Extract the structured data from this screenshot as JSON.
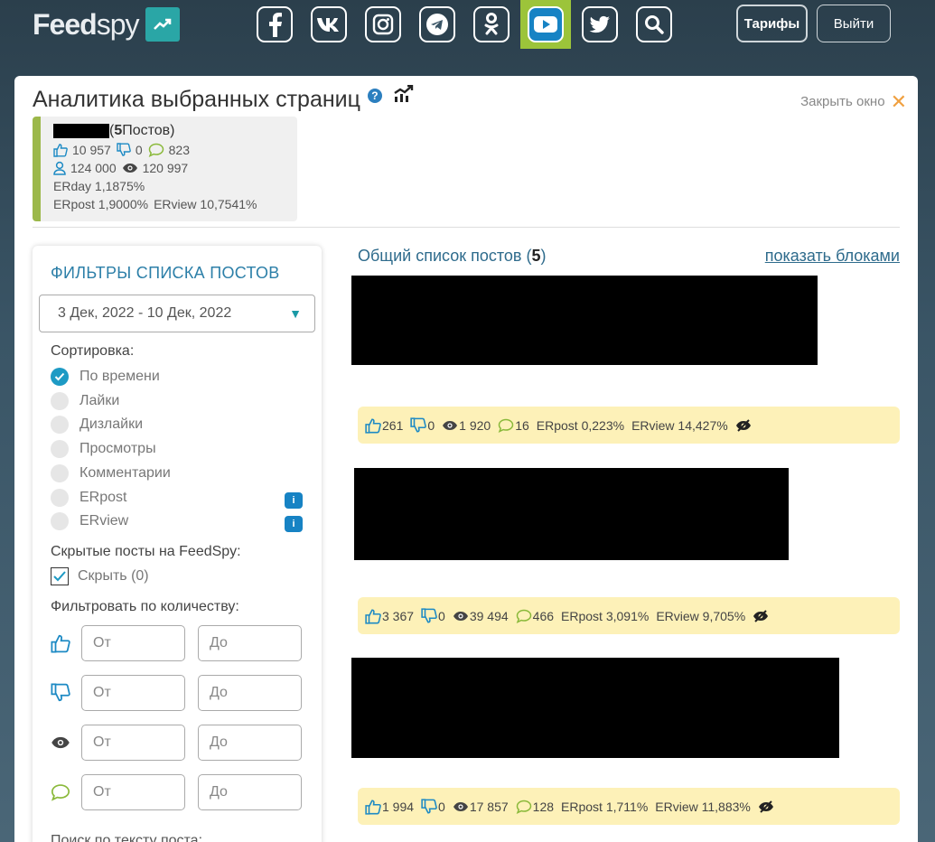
{
  "brand": {
    "feed": "Feed",
    "spy": "spy"
  },
  "nav": [
    {
      "name": "facebook-icon",
      "glyph": "f"
    },
    {
      "name": "vk-icon",
      "glyph": "vk"
    },
    {
      "name": "instagram-icon",
      "glyph": "ig"
    },
    {
      "name": "telegram-icon",
      "glyph": "tg"
    },
    {
      "name": "odnoklassniki-icon",
      "glyph": "ok"
    },
    {
      "name": "youtube-icon",
      "glyph": "yt",
      "active": true
    },
    {
      "name": "twitter-icon",
      "glyph": "tw"
    },
    {
      "name": "search-icon",
      "glyph": "search"
    }
  ],
  "header": {
    "tariffs_label": "Тарифы",
    "exit_label": "Выйти"
  },
  "page": {
    "title": "Аналитика выбранных страниц",
    "help": "?",
    "close_label": "Закрыть окно",
    "close_x": "✕"
  },
  "summary": {
    "posts_count": "5",
    "posts_label": " Постов)",
    "open_paren": "(",
    "likes": "10 957",
    "dislikes": "0",
    "comments": "823",
    "subscribers": "124 000",
    "views": "120 997",
    "erday": "ERday 1,1875%",
    "erpost": "ERpost 1,9000%",
    "erview": "ERview 10,7541%"
  },
  "filters": {
    "title": "ФИЛЬТРЫ СПИСКА ПОСТОВ",
    "date_range": "3 Дек, 2022 - 10 Дек, 2022",
    "sort_label": "Сортировка:",
    "sort_options": [
      "По времени",
      "Лайки",
      "Дизлайки",
      "Просмотры",
      "Комментарии",
      "ERpost",
      "ERview"
    ],
    "sort_selected": "По времени",
    "hidden_label": "Скрытые посты на FeedSpy:",
    "hide_label": "Скрыть (0)",
    "qty_label": "Фильтровать по количеству:",
    "from_placeholder": "От",
    "to_placeholder": "До",
    "search_label": "Поиск по тексту поста:"
  },
  "list": {
    "title_prefix": "Общий список постов (",
    "count": "5",
    "title_suffix": ")",
    "show_blocks": "показать блоками"
  },
  "posts": [
    {
      "likes": "261",
      "dislikes": "0",
      "views": "1 920",
      "comments": "16",
      "erpost": "ERpost 0,223%",
      "erview": "ERview 14,427%"
    },
    {
      "likes": "3 367",
      "dislikes": "0",
      "views": "39 494",
      "comments": "466",
      "erpost": "ERpost 3,091%",
      "erview": "ERview 9,705%"
    },
    {
      "likes": "1 994",
      "dislikes": "0",
      "views": "17 857",
      "comments": "128",
      "erpost": "ERpost 1,711%",
      "erview": "ERview 11,883%"
    }
  ],
  "colors": {
    "accent": "#1d9ac4",
    "brand_green": "#9cb84a",
    "youtube_blue": "#1783c4",
    "stats_bg": "#fdf1b8"
  }
}
